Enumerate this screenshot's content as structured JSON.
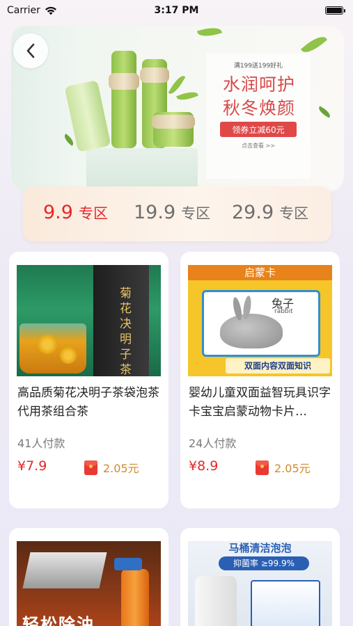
{
  "status_bar": {
    "carrier": "Carrier",
    "time": "3:17 PM"
  },
  "banner": {
    "promo_small": "满199送199好礼",
    "promo_line1": "水润呵护",
    "promo_line2": "秋冬焕颜",
    "coupon": "领券立减60元",
    "link": "点击查看 >>"
  },
  "zones": [
    {
      "price": "9.9",
      "suffix": "专区",
      "active": true
    },
    {
      "price": "19.9",
      "suffix": "专区",
      "active": false
    },
    {
      "price": "29.9",
      "suffix": "专区",
      "active": false
    }
  ],
  "products": [
    {
      "title": "高品质菊花决明子茶袋泡茶代用茶组合茶",
      "sold": "41人付款",
      "price": "¥7.9",
      "bonus": "2.05元",
      "image_label": "菊花决明子茶"
    },
    {
      "title": "婴幼儿童双面益智玩具识字卡宝宝启蒙动物卡片…",
      "sold": "24人付款",
      "price": "¥8.9",
      "bonus": "2.05元",
      "image_label": "启蒙卡",
      "image_banner": "双面内容双面知识",
      "image_word": "兔子",
      "image_word_en": "rabbit"
    },
    {
      "title": "",
      "sold": "",
      "price": "",
      "bonus": "",
      "image_label": "轻松除油"
    },
    {
      "title": "",
      "sold": "",
      "price": "",
      "bonus": "",
      "image_label": "马桶清洁泡泡",
      "image_banner": "抑菌率 ≥99.9%"
    }
  ],
  "colors": {
    "accent": "#e8262a",
    "bonus": "#d18a2a"
  }
}
